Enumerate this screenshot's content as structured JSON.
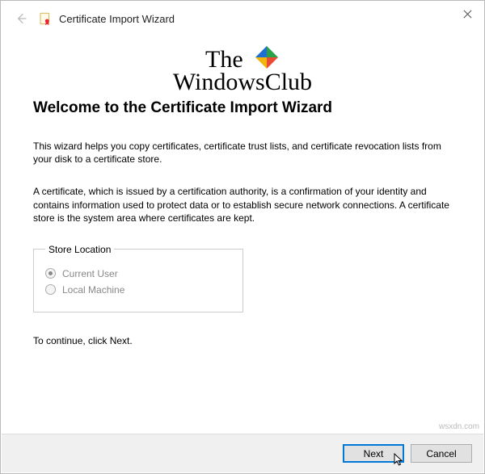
{
  "header": {
    "title": "Certificate Import Wizard"
  },
  "watermark": {
    "line1": "The",
    "line2": "WindowsClub"
  },
  "main": {
    "heading": "Welcome to the Certificate Import Wizard",
    "para1": "This wizard helps you copy certificates, certificate trust lists, and certificate revocation lists from your disk to a certificate store.",
    "para2": "A certificate, which is issued by a certification authority, is a confirmation of your identity and contains information used to protect data or to establish secure network connections. A certificate store is the system area where certificates are kept.",
    "group_legend": "Store Location",
    "radio1": "Current User",
    "radio2": "Local Machine",
    "continue": "To continue, click Next."
  },
  "footer": {
    "next": "Next",
    "cancel": "Cancel"
  },
  "source": "wsxdn.com"
}
